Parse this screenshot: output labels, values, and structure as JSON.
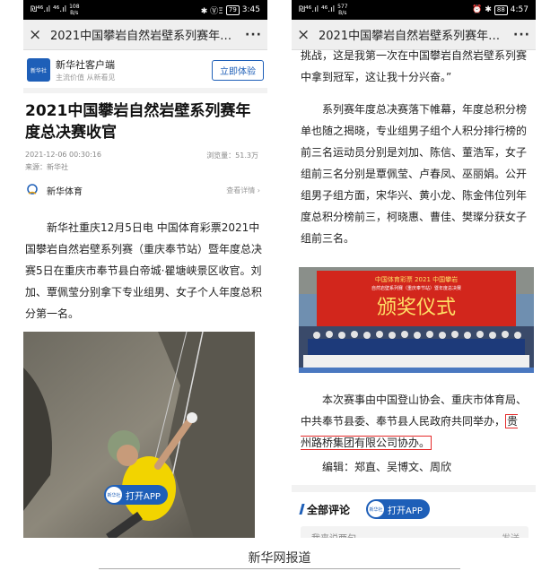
{
  "left_phone": {
    "status": {
      "net": "₪⁴⁶.ıl ⁴⁶.ıl",
      "speed": "108",
      "speed_unit": "B/s",
      "icons": "✱ ⓋΞ",
      "battery": "79",
      "time": "3:45"
    },
    "nav": {
      "close_icon": "×",
      "title": "2021中国攀岩自然岩壁系列赛年度...",
      "more_icon": "···"
    },
    "app_banner": {
      "logo_text": "新华社",
      "name": "新华社客户端",
      "slogan": "主流价值 从新看见",
      "button": "立即体验"
    },
    "article": {
      "title": "2021中国攀岩自然岩壁系列赛年度总决赛收官",
      "datetime": "2021-12-06 00:30:16",
      "views": "浏览量：51.3万",
      "source": "来源：新华社",
      "channel": "新华体育",
      "channel_more": "查看详情 ›",
      "lead": "新华社重庆12月5日电 中国体育彩票2021中国攀岩自然岩壁系列赛（重庆奉节站）暨年度总决赛5日在重庆市奉节县白帝城·瞿塘峡景区收官。刘加、覃佩莹分别拿下专业组男、女子个人年度总积分第一名。"
    },
    "open_app": {
      "logo_text": "新华社",
      "label": "打开APP"
    }
  },
  "right_phone": {
    "status": {
      "net": "₪⁴⁶.ıl ⁴⁶.ıl",
      "speed": "577",
      "speed_unit": "B/s",
      "icons": "⏰ ✱",
      "battery": "88",
      "time": "4:57"
    },
    "nav": {
      "close_icon": "×",
      "title": "2021中国攀岩自然岩壁系列赛年度...",
      "more_icon": "···"
    },
    "para_top": "挑战，这是我第一次在中国攀岩自然岩壁系列赛中拿到冠军，这让我十分兴奋。”",
    "para_results": "系列赛年度总决赛落下帷幕，年度总积分榜单也随之揭晓，专业组男子组个人积分排行榜的前三名运动员分别是刘加、陈信、董浩军，女子组前三名分别是覃佩莹、卢春凤、巫丽娟。公开组男子组方面，宋华兴、黄小龙、陈金伟位列年度总积分榜前三，柯晓惠、曹佳、樊璨分获女子组前三名。",
    "photo_banner": "中国体育彩票 2021 中国攀岩",
    "photo_banner_sub": "自然岩壁系列赛（重庆奉节站）暨年度总决赛",
    "photo_ceremony": "颁奖仪式",
    "para_sponsors": "本次赛事由中国登山协会、重庆市体育局、中共奉节县委、奉节县人民政府共同举办，",
    "para_highlight": "贵州路桥集团有限公司协办。",
    "editors": "编辑：郑直、吴博文、周欣",
    "comments": {
      "title": "全部评论",
      "open_app_logo": "新华社",
      "open_app_label": "打开APP",
      "placeholder": "我来说两句......",
      "send": "发送"
    }
  },
  "caption": "新华网报道",
  "colors": {
    "accent": "#1e5fb8",
    "highlight": "#e52b2b"
  }
}
